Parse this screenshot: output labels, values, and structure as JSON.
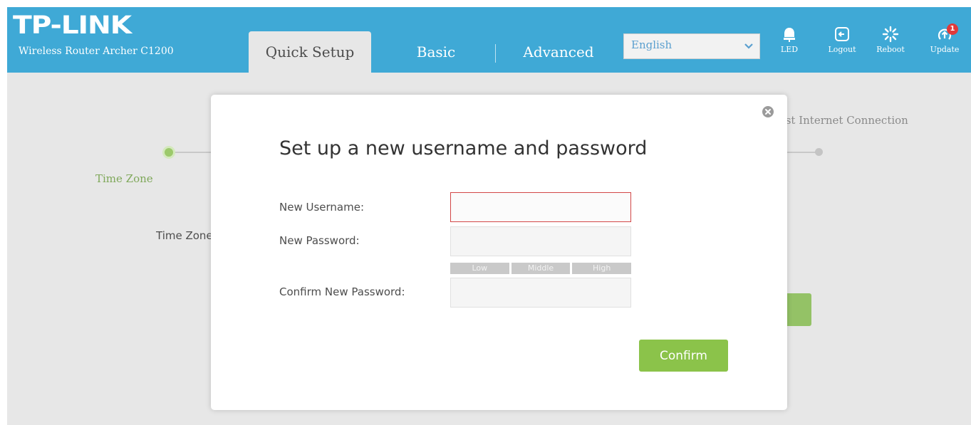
{
  "header": {
    "logo": "TP-LINK",
    "model": "Wireless Router Archer C1200",
    "tabs": [
      {
        "label": "Quick Setup",
        "active": true
      },
      {
        "label": "Basic",
        "active": false
      },
      {
        "label": "Advanced",
        "active": false
      }
    ],
    "language": {
      "selected": "English"
    },
    "buttons": [
      {
        "label": "LED",
        "icon": "bulb-icon"
      },
      {
        "label": "Logout",
        "icon": "logout-icon"
      },
      {
        "label": "Reboot",
        "icon": "reboot-icon"
      },
      {
        "label": "Update",
        "icon": "update-icon",
        "badge": "1"
      }
    ],
    "colors": {
      "bar": "#3fa9d6",
      "accent": "#8bc34a",
      "badge": "#e03a3a"
    }
  },
  "wizard": {
    "step_current": "Time Zone",
    "step_last": "Test Internet Connection",
    "field_label": "Time Zone"
  },
  "modal": {
    "title": "Set up a new username and password",
    "fields": [
      {
        "label": "New Username:",
        "value": ""
      },
      {
        "label": "New Password:",
        "value": ""
      },
      {
        "label": "Confirm New Password:",
        "value": ""
      }
    ],
    "strength": [
      "Low",
      "Middle",
      "High"
    ],
    "confirm_label": "Confirm"
  }
}
